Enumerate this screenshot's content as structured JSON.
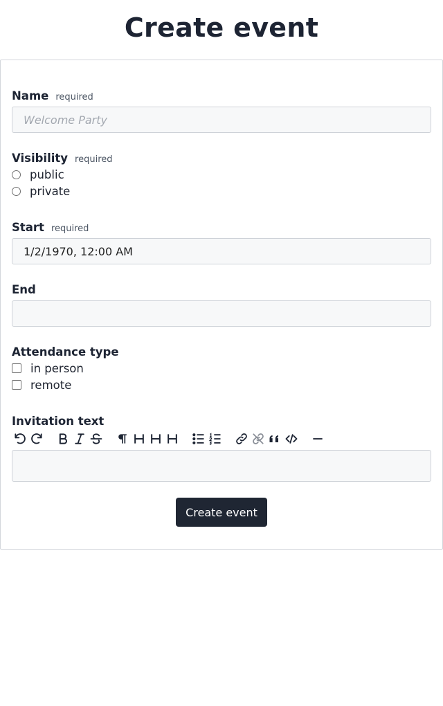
{
  "page": {
    "title": "Create event"
  },
  "form": {
    "name": {
      "label": "Name",
      "required": "required",
      "placeholder": "Welcome Party",
      "value": ""
    },
    "visibility": {
      "label": "Visibility",
      "required": "required",
      "options": [
        "public",
        "private"
      ]
    },
    "start": {
      "label": "Start",
      "required": "required",
      "value": "1/2/1970, 12:00 AM"
    },
    "end": {
      "label": "End",
      "value": ""
    },
    "attendance": {
      "label": "Attendance type",
      "options": [
        "in person",
        "remote"
      ]
    },
    "invitation": {
      "label": "Invitation text",
      "toolbar": [
        "undo-icon",
        "redo-icon",
        "bold-icon",
        "italic-icon",
        "strikethrough-icon",
        "paragraph-icon",
        "heading-1-icon",
        "heading-2-icon",
        "heading-3-icon",
        "bullet-list-icon",
        "ordered-list-icon",
        "link-icon",
        "unlink-icon",
        "blockquote-icon",
        "code-icon",
        "horizontal-rule-icon"
      ]
    },
    "submit_label": "Create event"
  }
}
